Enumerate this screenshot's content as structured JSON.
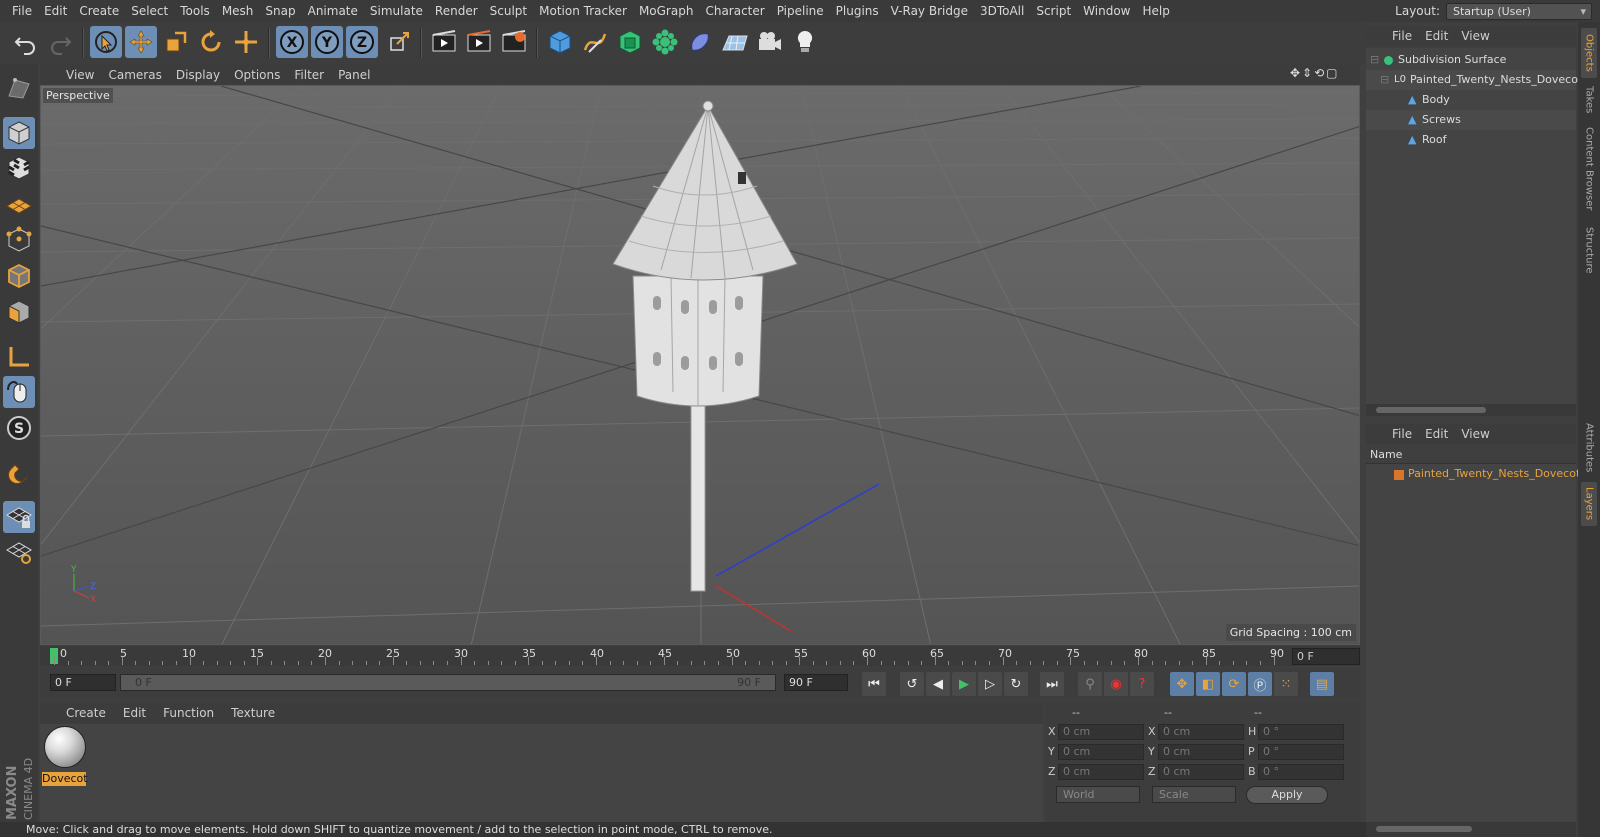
{
  "menubar": [
    "File",
    "Edit",
    "Create",
    "Select",
    "Tools",
    "Mesh",
    "Snap",
    "Animate",
    "Simulate",
    "Render",
    "Sculpt",
    "Motion Tracker",
    "MoGraph",
    "Character",
    "Pipeline",
    "Plugins",
    "V-Ray Bridge",
    "3DToAll",
    "Script",
    "Window",
    "Help"
  ],
  "layout": {
    "label": "Layout:",
    "value": "Startup (User)"
  },
  "toolbar_axes": [
    "X",
    "Y",
    "Z"
  ],
  "viewport": {
    "menu": [
      "View",
      "Cameras",
      "Display",
      "Options",
      "Filter",
      "Panel"
    ],
    "label": "Perspective",
    "grid_spacing": "Grid Spacing : 100 cm"
  },
  "timeline": {
    "ticks": [
      "0",
      "5",
      "10",
      "15",
      "20",
      "25",
      "30",
      "35",
      "40",
      "45",
      "50",
      "55",
      "60",
      "65",
      "70",
      "75",
      "80",
      "85",
      "90"
    ],
    "current_frame": "0 F"
  },
  "transport": {
    "start_field": "0 F",
    "range_start": "0 F",
    "range_end": "90 F",
    "end_field": "90 F"
  },
  "materials": {
    "menu": [
      "Create",
      "Edit",
      "Function",
      "Texture"
    ],
    "items": [
      {
        "label": "Dovecot"
      }
    ]
  },
  "coordinates": {
    "headers": [
      "--",
      "--",
      "--"
    ],
    "rows": [
      {
        "a": "X",
        "av": "0 cm",
        "b": "X",
        "bv": "0 cm",
        "c": "H",
        "cv": "0 °"
      },
      {
        "a": "Y",
        "av": "0 cm",
        "b": "Y",
        "bv": "0 cm",
        "c": "P",
        "cv": "0 °"
      },
      {
        "a": "Z",
        "av": "0 cm",
        "b": "Z",
        "bv": "0 cm",
        "c": "B",
        "cv": "0 °"
      }
    ],
    "mode1": "World",
    "mode2": "Scale",
    "apply": "Apply"
  },
  "status": "Move: Click and drag to move elements. Hold down SHIFT to quantize movement / add to the selection in point mode, CTRL to remove.",
  "objects": {
    "menu": [
      "File",
      "Edit",
      "View"
    ],
    "tree": [
      {
        "name": "Subdivision Surface",
        "depth": 0
      },
      {
        "name": "Painted_Twenty_Nests_Dovecote",
        "depth": 1
      },
      {
        "name": "Body",
        "depth": 2
      },
      {
        "name": "Screws",
        "depth": 2
      },
      {
        "name": "Roof",
        "depth": 2
      }
    ]
  },
  "layers": {
    "menu": [
      "File",
      "Edit",
      "View"
    ],
    "header": "Name",
    "items": [
      {
        "name": "Painted_Twenty_Nests_Dovecote_"
      }
    ]
  },
  "vertical_tabs": [
    "Objects",
    "Takes",
    "Content Browser",
    "Structure",
    "Attributes",
    "Layers"
  ],
  "colors": {
    "accent_orange": "#e8a33d",
    "selected_blue": "#6d8fb5",
    "layer_color": "#d9762b"
  }
}
